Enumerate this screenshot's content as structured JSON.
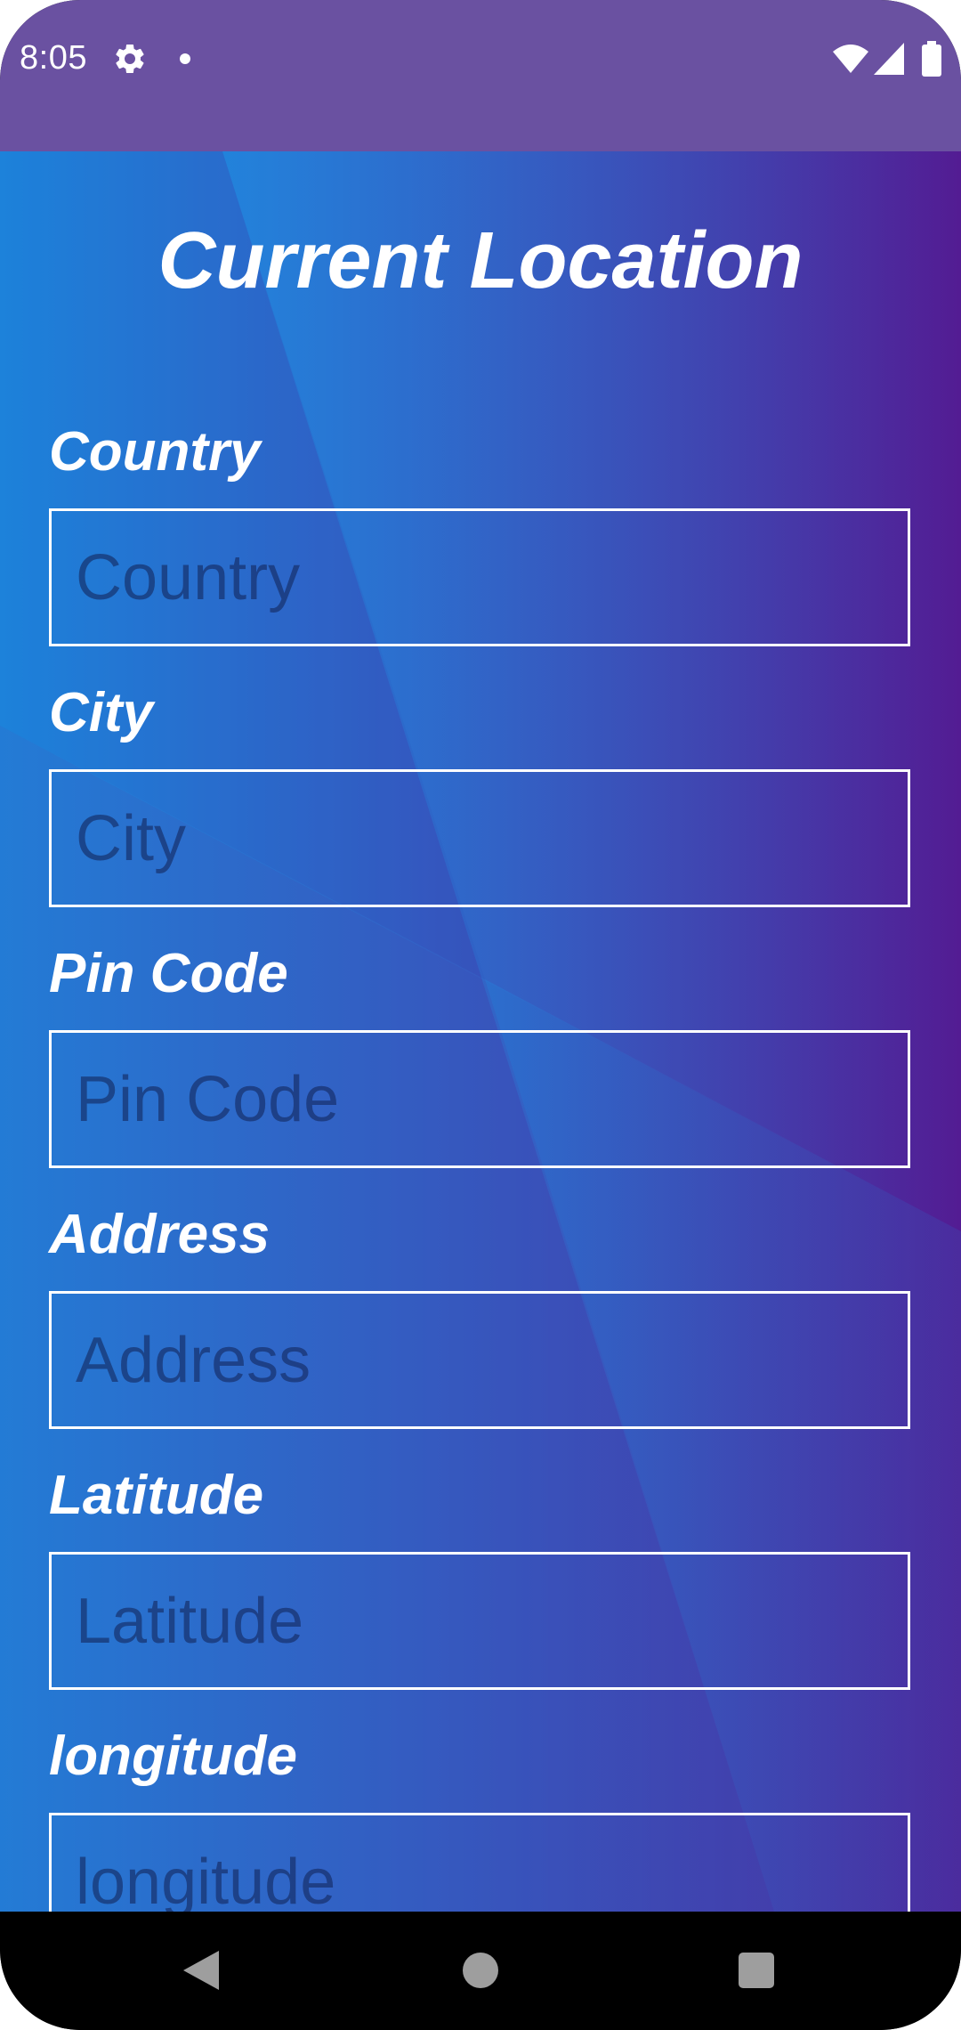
{
  "status_bar": {
    "time": "8:05",
    "icons": [
      "gear-icon",
      "notification-dot-icon",
      "wifi-icon",
      "signal-icon",
      "battery-icon"
    ],
    "background": "#6a51a1"
  },
  "screen": {
    "title": "Current Location",
    "colors": {
      "gradient_start": "#1a8be0",
      "gradient_end": "#531c93",
      "text": "#ffffff",
      "field_border": "#ffffff"
    }
  },
  "form": {
    "fields": [
      {
        "label": "Country",
        "placeholder": "Country",
        "value": ""
      },
      {
        "label": "City",
        "placeholder": "City",
        "value": ""
      },
      {
        "label": "Pin Code",
        "placeholder": "Pin Code",
        "value": ""
      },
      {
        "label": "Address",
        "placeholder": "Address",
        "value": ""
      },
      {
        "label": "Latitude",
        "placeholder": "Latitude",
        "value": ""
      },
      {
        "label": "longitude",
        "placeholder": "longitude",
        "value": ""
      }
    ]
  },
  "nav_bar": {
    "buttons": [
      "back-icon",
      "home-icon",
      "recents-icon"
    ]
  }
}
